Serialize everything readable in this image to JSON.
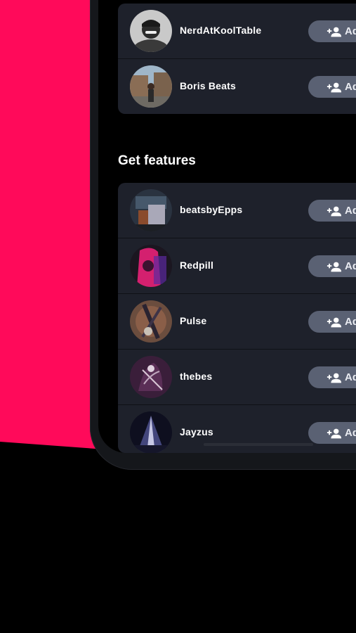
{
  "colors": {
    "accent_pink": "#ff0a5a",
    "card_bg": "#1e212b",
    "button_bg": "#5a6173"
  },
  "top_list": {
    "items": [
      {
        "name": "NerdAtKoolTable",
        "button": "Add",
        "avatar": "person-photo"
      },
      {
        "name": "Boris Beats",
        "button": "Add",
        "avatar": "street-photo"
      }
    ]
  },
  "features": {
    "title": "Get features",
    "items": [
      {
        "name": "beatsbyEpps",
        "button": "Add",
        "avatar": "studio-photo"
      },
      {
        "name": "Redpill",
        "button": "Add",
        "avatar": "neon-face-photo"
      },
      {
        "name": "Pulse",
        "button": "Add",
        "avatar": "guitar-photo"
      },
      {
        "name": "thebes",
        "button": "Add",
        "avatar": "guitarist-art"
      },
      {
        "name": "Jayzus",
        "button": "Add",
        "avatar": "concert-lights-photo"
      }
    ]
  }
}
